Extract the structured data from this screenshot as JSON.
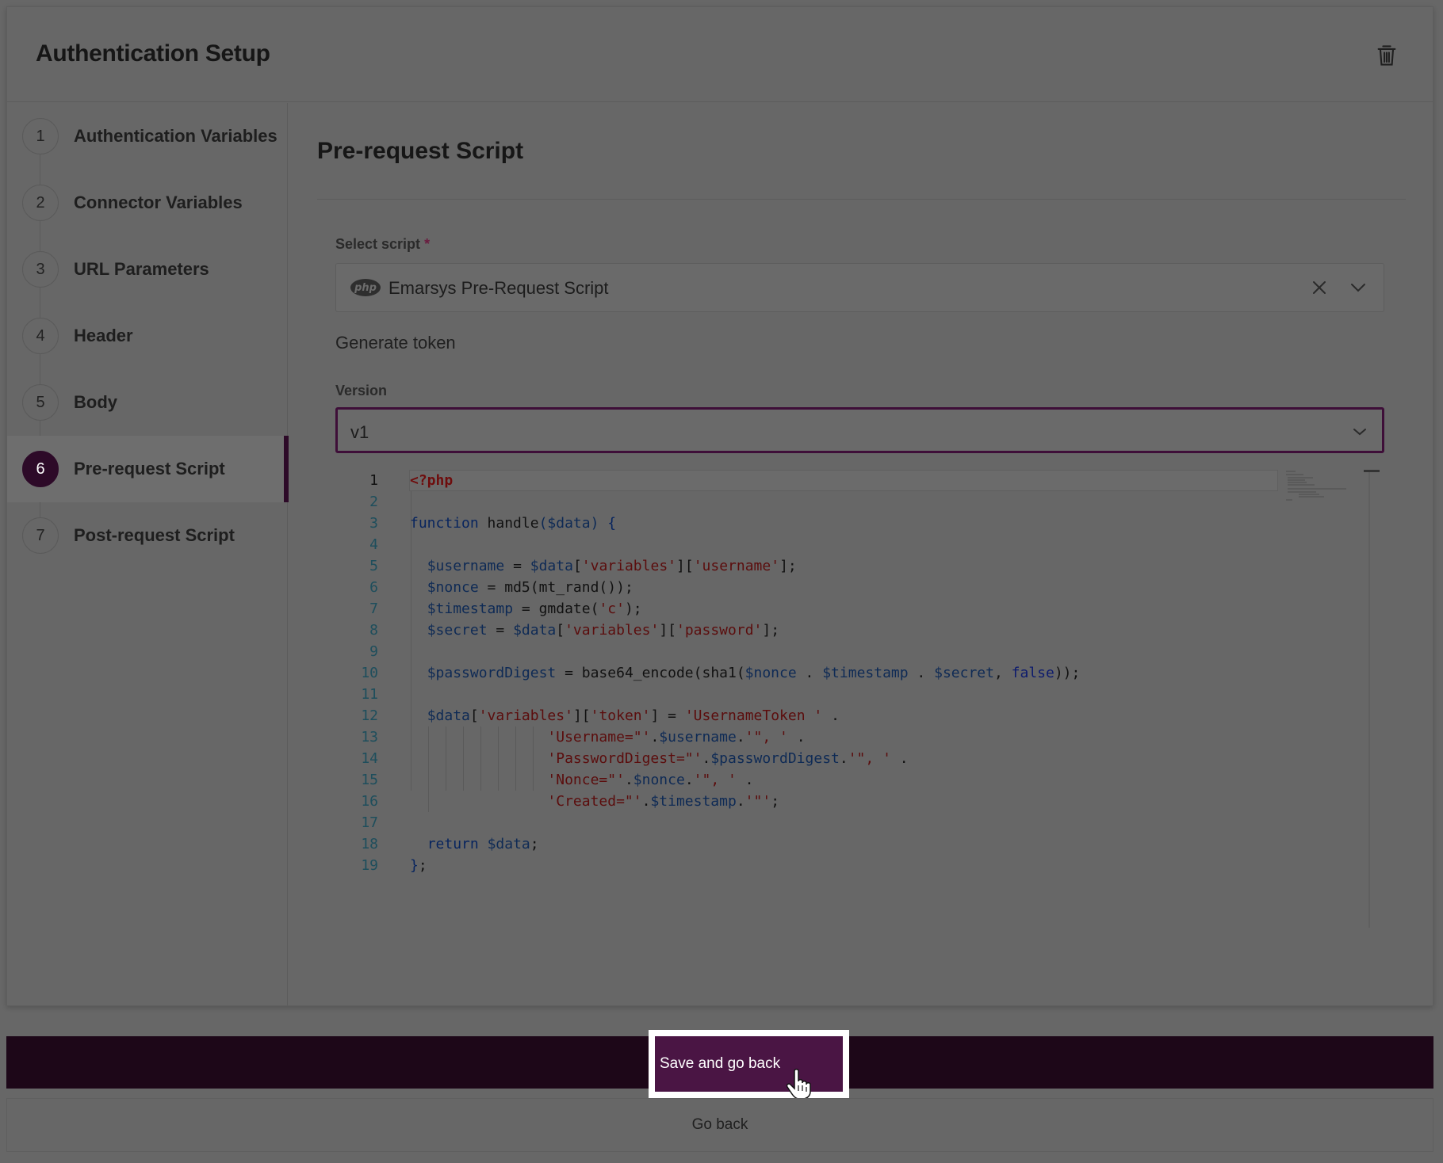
{
  "header": {
    "title": "Authentication Setup",
    "delete_icon": "trash-icon"
  },
  "sidebar": {
    "active_index": 6,
    "accent": "#2d0a28",
    "steps": [
      {
        "num": "1",
        "label": "Authentication Variables"
      },
      {
        "num": "2",
        "label": "Connector Variables"
      },
      {
        "num": "3",
        "label": "URL Parameters"
      },
      {
        "num": "4",
        "label": "Header"
      },
      {
        "num": "5",
        "label": "Body"
      },
      {
        "num": "6",
        "label": "Pre-request Script"
      },
      {
        "num": "7",
        "label": "Post-request Script"
      }
    ]
  },
  "main": {
    "section_title": "Pre-request Script",
    "select_script": {
      "label": "Select script",
      "required_mark": "*",
      "icon": "php-logo-icon",
      "icon_text": "php",
      "value": "Emarsys Pre-Request Script"
    },
    "description": "Generate token",
    "version": {
      "label": "Version",
      "value": "v1"
    },
    "code": {
      "line_numbers": [
        "1",
        "2",
        "3",
        "4",
        "5",
        "6",
        "7",
        "8",
        "9",
        "10",
        "11",
        "12",
        "13",
        "14",
        "15",
        "16",
        "17",
        "18",
        "19"
      ]
    }
  },
  "footer": {
    "save_label": "Save and go back",
    "go_back_label": "Go back",
    "save_color": "#4a1544",
    "bar_color": "#1d0718"
  }
}
